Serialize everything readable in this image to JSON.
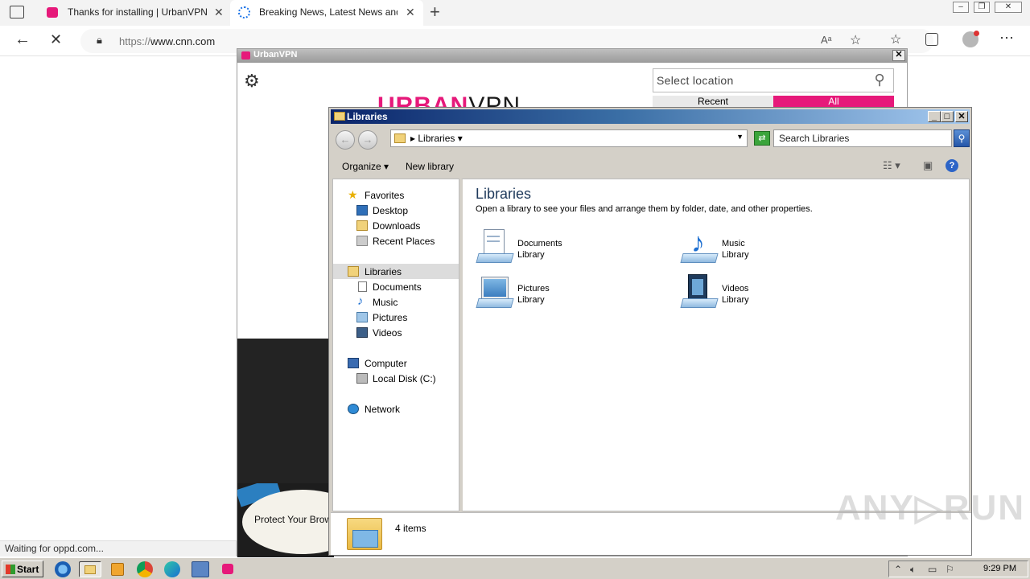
{
  "browser": {
    "tabs": [
      {
        "title": "Thanks for installing | UrbanVPN",
        "active": false
      },
      {
        "title": "Breaking News, Latest News and",
        "active": true
      }
    ],
    "url_scheme": "https://",
    "url_host": "www.cnn.com",
    "status_text": "Waiting for oppd.com..."
  },
  "urbanvpn": {
    "title": "UrbanVPN",
    "location_placeholder": "Select location",
    "tab_recent": "Recent",
    "tab_all": "All",
    "logo_text": "URBAN",
    "logo_vpn": "VPN",
    "banner_text": "Protect Your Brow"
  },
  "explorer": {
    "title": "Libraries",
    "path": "Libraries",
    "search_placeholder": "Search Libraries",
    "commands": {
      "organize": "Organize",
      "new_library": "New library"
    },
    "nav": {
      "favorites": "Favorites",
      "desktop": "Desktop",
      "downloads": "Downloads",
      "recent_places": "Recent Places",
      "libraries": "Libraries",
      "documents": "Documents",
      "music": "Music",
      "pictures": "Pictures",
      "videos": "Videos",
      "computer": "Computer",
      "local_disk": "Local Disk (C:)",
      "network": "Network"
    },
    "heading": "Libraries",
    "subheading": "Open a library to see your files and arrange them by folder, date, and other properties.",
    "libraries": [
      {
        "name": "Documents",
        "kind": "Library",
        "icon": "documents-library-icon"
      },
      {
        "name": "Music",
        "kind": "Library",
        "icon": "music-library-icon"
      },
      {
        "name": "Pictures",
        "kind": "Library",
        "icon": "pictures-library-icon"
      },
      {
        "name": "Videos",
        "kind": "Library",
        "icon": "videos-library-icon"
      }
    ],
    "item_count": "4 items"
  },
  "taskbar": {
    "start": "Start",
    "clock": "9:29 PM"
  },
  "watermark": "ANY RUN",
  "colors": {
    "brand_pink": "#e6197a",
    "title_blue": "#0a246a"
  }
}
